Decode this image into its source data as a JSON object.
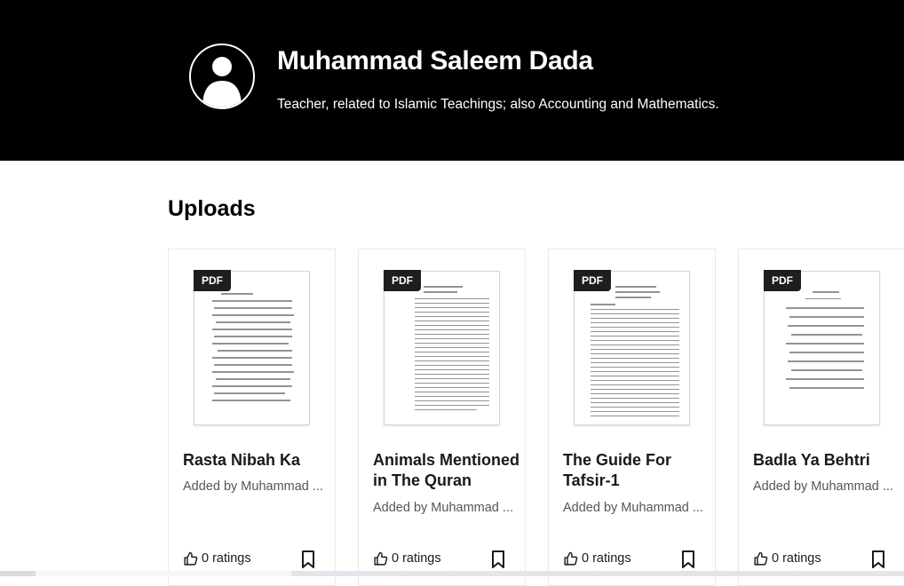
{
  "profile": {
    "name": "Muhammad Saleem Dada",
    "bio": "Teacher, related to Islamic Teachings; also Accounting and Mathematics.",
    "avatar_icon": "user-silhouette-icon"
  },
  "uploads": {
    "title": "Uploads",
    "items": [
      {
        "badge": "PDF",
        "title": "Rasta Nibah Ka",
        "author": "Added by Muhammad ...",
        "ratings": "0 ratings"
      },
      {
        "badge": "PDF",
        "title": "Animals Mentioned in The Quran",
        "author": "Added by Muhammad ...",
        "ratings": "0 ratings"
      },
      {
        "badge": "PDF",
        "title": "The Guide For Tafsir-1",
        "author": "Added by Muhammad ...",
        "ratings": "0 ratings"
      },
      {
        "badge": "PDF",
        "title": "Badla Ya Behtri",
        "author": "Added by Muhammad ...",
        "ratings": "0 ratings"
      }
    ]
  },
  "icons": {
    "rating": "thumbs-up-icon",
    "save": "bookmark-icon"
  },
  "colors": {
    "header_bg": "#000000",
    "header_text": "#ffffff",
    "badge_bg": "#1e1e1e"
  }
}
